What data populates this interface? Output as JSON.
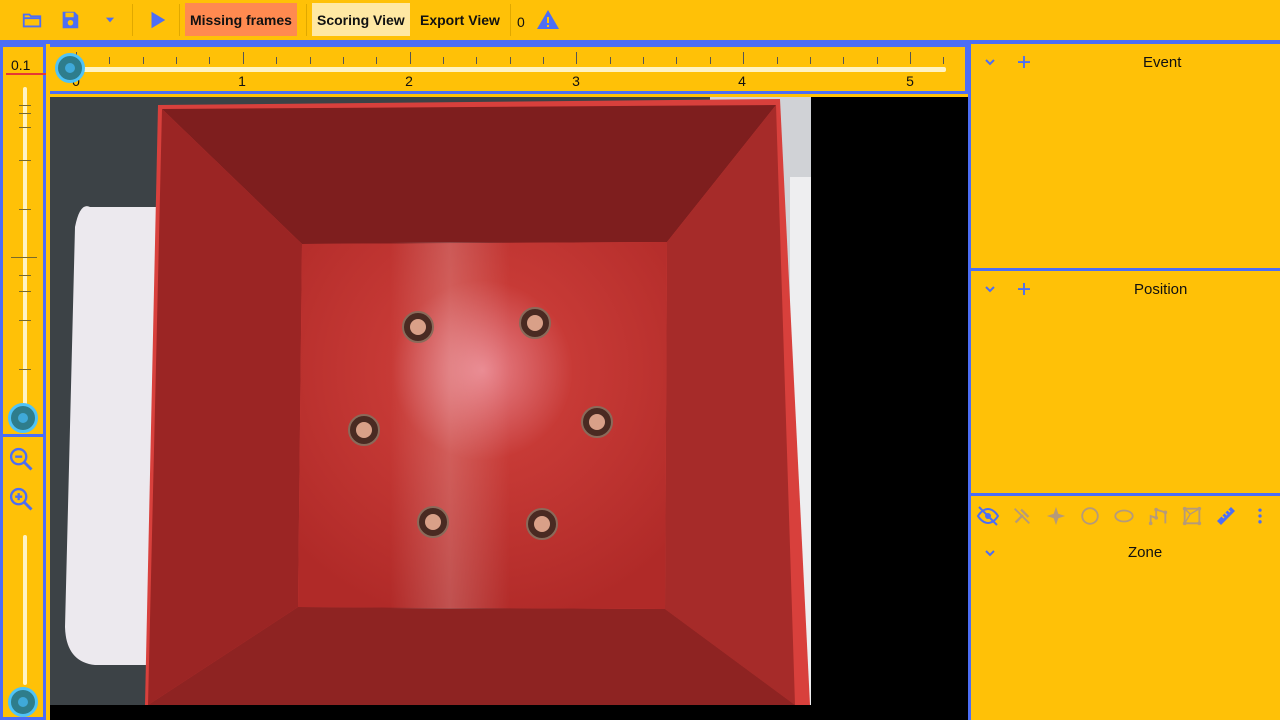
{
  "toolbar": {
    "icons": [
      "folder-open-icon",
      "save-icon",
      "dropdown-icon",
      "play-icon",
      "warning-icon"
    ],
    "missing_frames": "Missing frames",
    "scoring_view": "Scoring View",
    "export_view": "Export View",
    "warning_count": "0"
  },
  "speed": {
    "value": "0.1"
  },
  "timeline": {
    "labels": [
      "0",
      "1",
      "2",
      "3",
      "4",
      "5"
    ],
    "position": 0
  },
  "panels": {
    "event": {
      "title": "Event"
    },
    "position": {
      "title": "Position"
    },
    "zone": {
      "title": "Zone"
    }
  },
  "zone_tools": [
    "hide-icon",
    "remove-point-icon",
    "add-point-icon",
    "circle-icon",
    "ellipse-icon",
    "polyline-icon",
    "polygon-icon",
    "ruler-icon",
    "more-vert-icon"
  ],
  "colors": {
    "background": "#FFC107",
    "accent": "#4C6EF5",
    "missing_frames": "#FF8A50",
    "scoring_view": "#FFE8A3"
  }
}
